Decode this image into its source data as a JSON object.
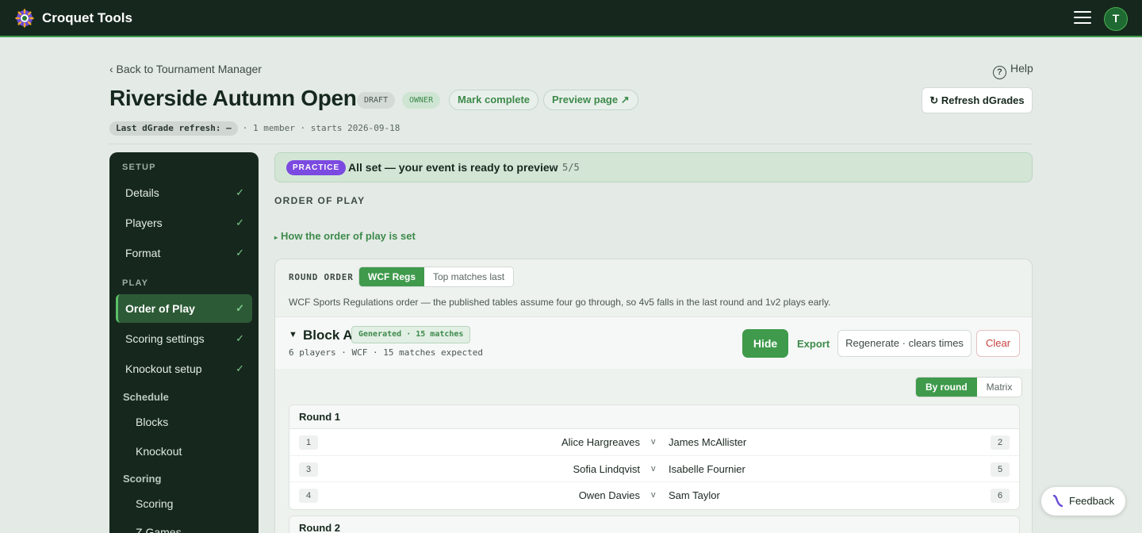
{
  "app": {
    "title": "Croquet Tools",
    "avatar_initial": "T"
  },
  "nav": {
    "back": "‹ Back to Tournament Manager",
    "help": "Help",
    "help_glyph": "?"
  },
  "event": {
    "title": "Riverside Autumn Open",
    "status_badge": "DRAFT",
    "role_badge": "OWNER",
    "mark_complete": "Mark complete",
    "preview_page": "Preview page ↗",
    "refresh_button": "Refresh dGrades",
    "last_refresh": "Last dGrade refresh: —",
    "meta": "· 1 member · starts 2026-09-18"
  },
  "sidebar": {
    "setup_label": "SETUP",
    "play_label": "PLAY",
    "items": [
      {
        "label": "Details",
        "check": "✓"
      },
      {
        "label": "Players",
        "check": "✓"
      },
      {
        "label": "Format",
        "check": "✓"
      },
      {
        "label": "Order of Play",
        "check": "✓"
      },
      {
        "label": "Scoring settings",
        "check": "✓"
      },
      {
        "label": "Knockout setup",
        "check": "✓"
      }
    ],
    "schedule_label": "Schedule",
    "schedule_items": [
      "Blocks",
      "Knockout"
    ],
    "scoring_label": "Scoring",
    "scoring_items": [
      "Scoring",
      "Z Games"
    ]
  },
  "banner": {
    "badge": "PRACTICE",
    "text": "All set — your event is ready to preview",
    "separator": "•",
    "count": "5/5"
  },
  "section": {
    "heading": "ORDER OF PLAY",
    "how_link": "How the order of play is set",
    "how_glyph": "▸"
  },
  "round_order": {
    "label": "ROUND ORDER",
    "options": [
      "WCF Regs",
      "Top matches last"
    ],
    "selected": "WCF Regs",
    "description": "WCF Sports Regulations order — the published tables assume four go through, so 4v5 falls in the last round and 1v2 plays early."
  },
  "block": {
    "toggle_glyph": "▼",
    "title": "Block A",
    "badge": "Generated · 15 matches",
    "meta": "6 players · WCF · 15 matches expected",
    "hide": "Hide",
    "export": "Export",
    "regenerate": "Regenerate · clears times",
    "clear": "Clear"
  },
  "view_toggle": {
    "options": [
      "By round",
      "Matrix"
    ],
    "selected": "By round"
  },
  "rounds": [
    {
      "title": "Round 1",
      "matches": [
        {
          "left_num": "1",
          "player1": "Alice Hargreaves",
          "vs": "v",
          "player2": "James McAllister",
          "right_num": "2"
        },
        {
          "left_num": "3",
          "player1": "Sofia Lindqvist",
          "vs": "v",
          "player2": "Isabelle Fournier",
          "right_num": "5"
        },
        {
          "left_num": "4",
          "player1": "Owen Davies",
          "vs": "v",
          "player2": "Sam Taylor",
          "right_num": "6"
        }
      ]
    },
    {
      "title": "Round 2",
      "matches": []
    }
  ],
  "feedback": {
    "label": "Feedback"
  },
  "colors": {
    "accent": "#3f9a4c",
    "topbar": "#16281d",
    "practice": "#7b4ae0",
    "danger": "#c94040"
  }
}
